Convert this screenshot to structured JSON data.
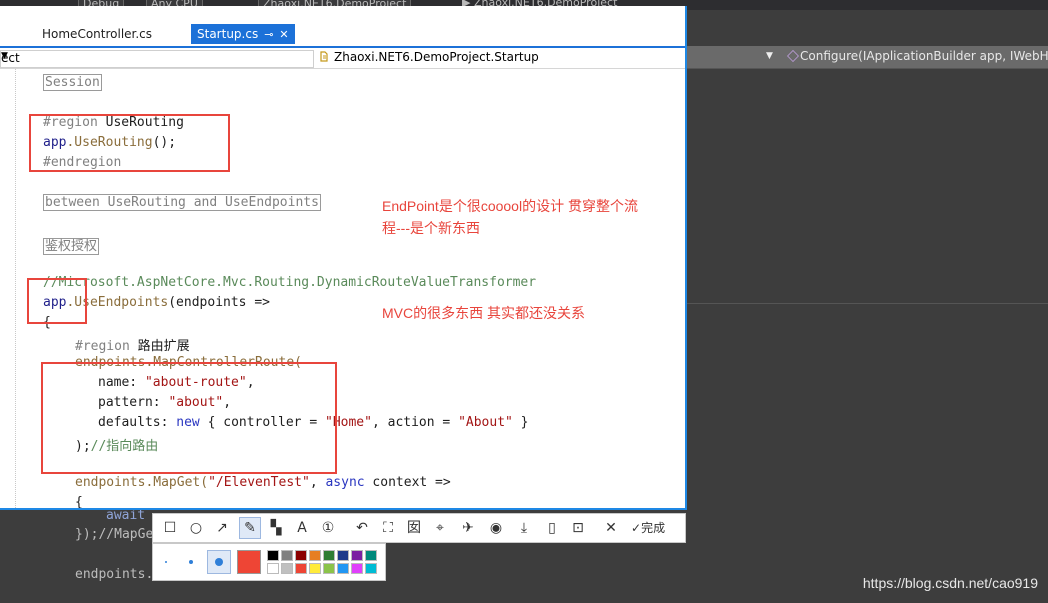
{
  "background": {
    "toolbar": {
      "config": "Debug",
      "platform": "Any CPU",
      "project_dd": "Zhaoxi.NET6.DemoProject",
      "run_target": "Zhaoxi.NET6.DemoProject"
    },
    "nav_right": "Configure(IApplicationBuilder app, IWebHos",
    "code": {
      "await": "await",
      "mapget_close": "});//MapGe",
      "endpoints": "endpoints."
    },
    "watermark": "https://blog.csdn.net/cao919"
  },
  "editor": {
    "tabs": [
      {
        "label": "HomeController.cs",
        "active": false
      },
      {
        "label": "Startup.cs",
        "active": true,
        "pin": "⊸",
        "close": "✕"
      }
    ],
    "nav": {
      "left": "ect",
      "middle": "Zhaoxi.NET6.DemoProject.Startup"
    },
    "lines": {
      "session": "Session",
      "region_kw": "#region",
      "region_name": " UseRouting",
      "app1": "app",
      "userouting": ".UseRouting",
      "userouting_tail": "();",
      "endregion": "#endregion",
      "between": "between UseRouting and UseEndpoints",
      "auth": "鉴权授权",
      "comment_transformer": "//Microsoft.AspNetCore.Mvc.Routing.DynamicRouteValueTransformer",
      "app2": "app",
      "useendpoints": ".UseEndpoints",
      "useendpoints_tail": "(endpoints =>",
      "brace_open": "{",
      "region2_kw": "#region",
      "region2_name": " 路由扩展",
      "mapcontroller": "endpoints.MapControllerRoute(",
      "name_key": "name: ",
      "name_val": "\"about-route\"",
      "name_comma": ",",
      "pattern_key": "pattern: ",
      "pattern_val": "\"about\"",
      "pattern_comma": ",",
      "defaults_key": "defaults: ",
      "defaults_new": "new",
      "defaults_open": " { controller = ",
      "defaults_ctrl": "\"Home\"",
      "defaults_mid": ", action = ",
      "defaults_action": "\"About\"",
      "defaults_close": " }",
      "close_paren": ");",
      "close_comment": "//指向路由",
      "mapget": "endpoints.MapGet(",
      "mapget_route": "\"/ElevenTest\"",
      "mapget_comma": ", ",
      "mapget_async": "async",
      "mapget_tail": " context =>",
      "brace_open2": "{"
    }
  },
  "annotations": {
    "note1_line1": "EndPoint是个很cooool的设计  贯穿整个流",
    "note1_line2": "程---是个新东西",
    "note2": "MVC的很多东西 其实都还没关系",
    "color": "#e8453c"
  },
  "snip_toolbar": {
    "tools": [
      {
        "name": "rectangle",
        "glyph": "☐"
      },
      {
        "name": "ellipse",
        "glyph": "○"
      },
      {
        "name": "arrow",
        "glyph": "↗"
      },
      {
        "name": "pen",
        "glyph": "✎",
        "selected": true
      },
      {
        "name": "mosaic",
        "glyph": "▚"
      },
      {
        "name": "text",
        "glyph": "A"
      },
      {
        "name": "number",
        "glyph": "①"
      },
      {
        "name": "undo",
        "glyph": "↶"
      },
      {
        "name": "ocr",
        "glyph": "⛶"
      },
      {
        "name": "translate",
        "glyph": "囡"
      },
      {
        "name": "scan",
        "glyph": "⌖"
      },
      {
        "name": "pin",
        "glyph": "✈"
      },
      {
        "name": "record",
        "glyph": "◉"
      },
      {
        "name": "download",
        "glyph": "⤓"
      },
      {
        "name": "phone",
        "glyph": "▯"
      },
      {
        "name": "bookmark",
        "glyph": "⊡"
      },
      {
        "name": "cancel",
        "glyph": "✕"
      }
    ],
    "done_label": "完成",
    "current_color": "#ee4535",
    "palette": [
      "#000000",
      "#808080",
      "#8b0000",
      "#e67e22",
      "#2e7d32",
      "#1e3a8a",
      "#7b1fa2",
      "#00897b",
      "#ffffff",
      "#c0c0c0",
      "#ee4535",
      "#ffeb3b",
      "#8bc34a",
      "#2196f3",
      "#e040fb",
      "#00bcd4"
    ]
  }
}
